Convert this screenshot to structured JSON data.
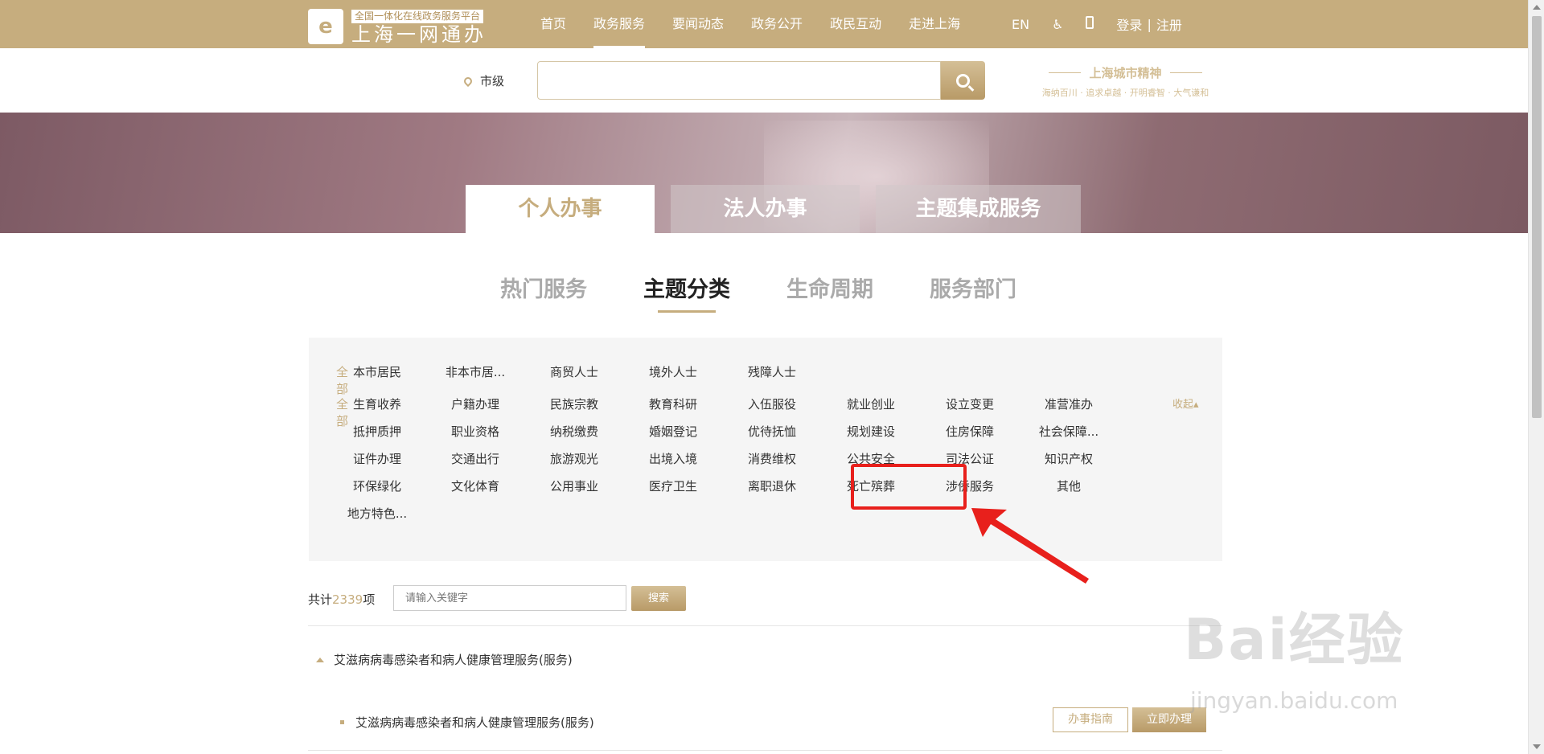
{
  "header": {
    "logo_sub": "全国一体化在线政务服务平台",
    "logo_main": "上海一网通办",
    "nav": [
      "首页",
      "政务服务",
      "要闻动态",
      "政务公开",
      "政民互动",
      "走进上海"
    ],
    "active_nav": "政务服务",
    "lang": "EN",
    "login": "登录",
    "register": "注册"
  },
  "search": {
    "location": "市级",
    "query": "",
    "spirit_title": "上海城市精神",
    "spirit_sub": "海纳百川 · 追求卓越 · 开明睿智 · 大气谦和"
  },
  "main_tabs": [
    "个人办事",
    "法人办事",
    "主题集成服务"
  ],
  "sub_tabs": [
    "热门服务",
    "主题分类",
    "生命周期",
    "服务部门"
  ],
  "categories": {
    "all_label": "全部",
    "groups": [
      "本市居民",
      "非本市居...",
      "商贸人士",
      "境外人士",
      "残障人士"
    ],
    "topics": [
      [
        "生育收养",
        "户籍办理",
        "民族宗教",
        "教育科研",
        "入伍服役",
        "就业创业",
        "设立变更",
        "准营准办"
      ],
      [
        "抵押质押",
        "职业资格",
        "纳税缴费",
        "婚姻登记",
        "优待抚恤",
        "规划建设",
        "住房保障",
        "社会保障..."
      ],
      [
        "证件办理",
        "交通出行",
        "旅游观光",
        "出境入境",
        "消费维权",
        "公共安全",
        "司法公证",
        "知识产权"
      ],
      [
        "环保绿化",
        "文化体育",
        "公用事业",
        "医疗卫生",
        "离职退休",
        "死亡殡葬",
        "涉侨服务",
        "其他"
      ],
      [
        "地方特色..."
      ]
    ],
    "collapse": "收起"
  },
  "results": {
    "count_prefix": "共计",
    "count": "2339",
    "count_suffix": "项",
    "keyword_placeholder": "请输入关键字",
    "search_btn": "搜索",
    "group_title": "艾滋病病毒感染者和病人健康管理服务(服务)",
    "item_title": "艾滋病病毒感染者和病人健康管理服务(服务)",
    "guide_btn": "办事指南",
    "do_btn": "立即办理"
  },
  "watermark": {
    "main": "Bai经验",
    "sub": "jingyan.baidu.com"
  },
  "colors": {
    "accent": "#c6ad7e",
    "highlight": "#e8201c"
  }
}
